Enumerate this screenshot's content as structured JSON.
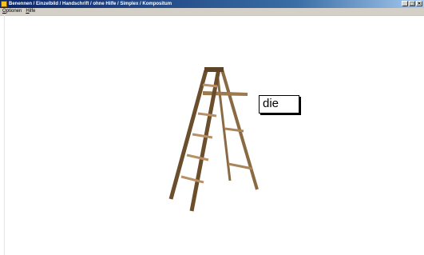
{
  "window": {
    "title": "Benennen / Einzelbild / Handschrift / ohne Hilfe / Simplex / Kompositum",
    "controls": [
      "minimize",
      "maximize",
      "close"
    ]
  },
  "menu": {
    "items": [
      "Optionen",
      "Hilfe"
    ]
  },
  "exercise": {
    "picture": "ladder",
    "word": "die"
  }
}
